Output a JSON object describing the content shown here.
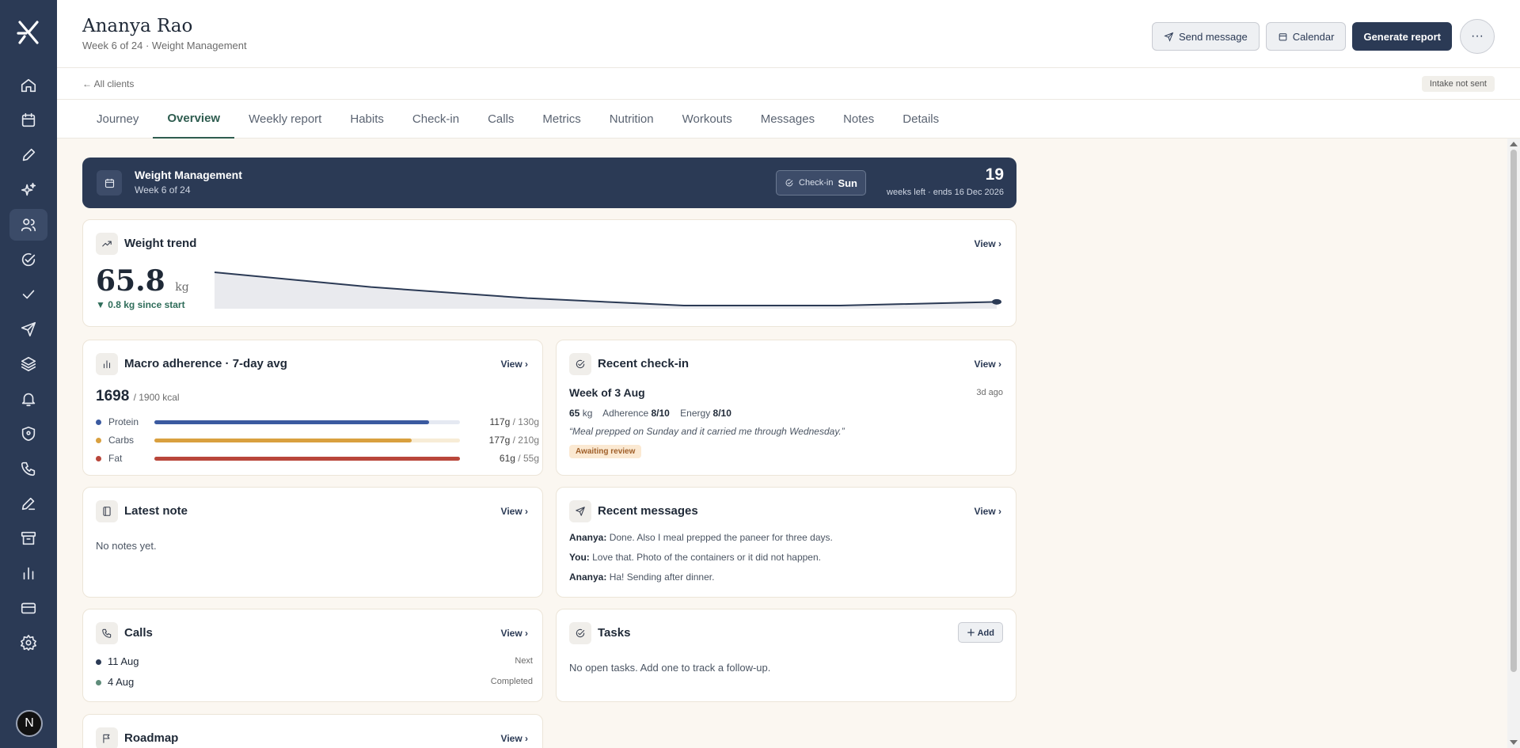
{
  "header": {
    "client_name": "Ananya Rao",
    "client_sub": "Week 6 of 24 · Weight Management",
    "send_message": "Send message",
    "calendar": "Calendar",
    "generate_report": "Generate report",
    "more": "···"
  },
  "subheader": {
    "back_link": "← All clients",
    "intake_badge": "Intake not sent"
  },
  "tabs": [
    "Journey",
    "Overview",
    "Weekly report",
    "Habits",
    "Check-in",
    "Calls",
    "Metrics",
    "Nutrition",
    "Workouts",
    "Messages",
    "Notes",
    "Details"
  ],
  "active_tab": "Overview",
  "sidebar": {
    "icons": [
      "home-icon",
      "calendar-icon",
      "pencil-icon",
      "sparkle-icon",
      "users-icon",
      "check-circle-icon",
      "check-icon",
      "send-icon",
      "layers-icon",
      "bell-icon",
      "shield-icon",
      "phone-icon",
      "edit-icon",
      "archive-icon",
      "bar-chart-icon",
      "credit-card-icon",
      "settings-icon"
    ],
    "active": "users-icon",
    "avatar": "N"
  },
  "banner": {
    "title": "Weight Management",
    "subtitle": "Week 6 of 24",
    "checkin_label": "Check-in",
    "checkin_day": "Sun",
    "weeks_left": "19",
    "weeks_sub": "weeks left · ends 16 Dec 2026"
  },
  "weight_trend": {
    "title": "Weight trend",
    "view": "View ›",
    "value": "65.8",
    "unit": "kg",
    "change": "▼ 0.8 kg since start",
    "points": [
      66.6,
      66.2,
      65.9,
      65.7,
      65.7,
      65.8
    ]
  },
  "macros": {
    "title": "Macro adherence · 7-day avg",
    "view": "View ›",
    "kcal": "1698",
    "kcal_target": "/ 1900 kcal",
    "items": [
      {
        "name": "Protein",
        "value": "117g",
        "target": "/ 130g",
        "pct": 0.9,
        "color": "#3b5aa0",
        "track": "#e5e9f2"
      },
      {
        "name": "Carbs",
        "value": "177g",
        "target": "/ 210g",
        "pct": 0.843,
        "color": "#d9a03f",
        "track": "#f7ecd6"
      },
      {
        "name": "Fat",
        "value": "61g",
        "target": "/ 55g",
        "pct": 1.0,
        "color": "#b9473b",
        "track": "#f2dcd8"
      }
    ]
  },
  "checkin": {
    "title": "Recent check-in",
    "view": "View ›",
    "week": "Week of 3 Aug",
    "ago": "3d ago",
    "weight": "65",
    "weight_unit": "kg",
    "adherence_label": "Adherence",
    "adherence": "8/10",
    "energy_label": "Energy",
    "energy": "8/10",
    "quote": "“Meal prepped on Sunday and it carried me through Wednesday.”",
    "status": "Awaiting review"
  },
  "latest_note": {
    "title": "Latest note",
    "view": "View ›",
    "empty": "No notes yet."
  },
  "messages": {
    "title": "Recent messages",
    "view": "View ›",
    "items": [
      {
        "who": "Ananya:",
        "text": "Done. Also I meal prepped the paneer for three days."
      },
      {
        "who": "You:",
        "text": "Love that. Photo of the containers or it did not happen."
      },
      {
        "who": "Ananya:",
        "text": "Ha! Sending after dinner."
      }
    ]
  },
  "calls": {
    "title": "Calls",
    "view": "View ›",
    "items": [
      {
        "date": "11 Aug",
        "status": "Next",
        "color": "#2b3a55"
      },
      {
        "date": "4 Aug",
        "status": "Completed",
        "color": "#5f8c7a"
      }
    ]
  },
  "tasks": {
    "title": "Tasks",
    "add": "＋ Add",
    "empty": "No open tasks. Add one to track a follow-up."
  },
  "roadmap": {
    "title": "Roadmap",
    "view": "View ›"
  }
}
